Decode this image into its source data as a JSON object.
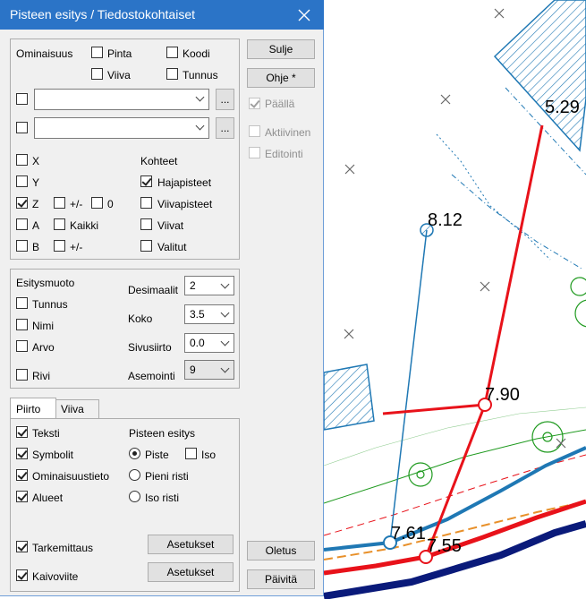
{
  "window": {
    "title": "Pisteen esitys / Tiedostokohtaiset"
  },
  "ominaisuus": {
    "label": "Ominaisuus",
    "pinta": "Pinta",
    "koodi": "Koodi",
    "viiva": "Viiva",
    "tunnus": "Tunnus",
    "browse": "..."
  },
  "coords": {
    "x": "X",
    "y": "Y",
    "z": "Z",
    "a": "A",
    "b": "B",
    "pm1": "+/-",
    "zero": "0",
    "kaikki": "Kaikki",
    "pm2": "+/-"
  },
  "kohteet": {
    "label": "Kohteet",
    "hajapisteet": "Hajapisteet",
    "viivapisteet": "Viivapisteet",
    "viivat": "Viivat",
    "valitut": "Valitut"
  },
  "buttons": {
    "sulje": "Sulje",
    "ohje": "Ohje *",
    "asetukset": "Asetukset",
    "oletus": "Oletus",
    "paivita": "Päivitä"
  },
  "right_options": {
    "paalla": "Päällä",
    "aktiivinen": "Aktiivinen",
    "editointi": "Editointi"
  },
  "esitysmuoto": {
    "label": "Esitysmuoto",
    "tunnus": "Tunnus",
    "nimi": "Nimi",
    "arvo": "Arvo",
    "rivi": "Rivi",
    "desimaalit_label": "Desimaalit",
    "desimaalit_value": "2",
    "koko_label": "Koko",
    "koko_value": "3.5",
    "sivusiirto_label": "Sivusiirto",
    "sivusiirto_value": "0.0",
    "asemointi_label": "Asemointi",
    "asemointi_value": "9"
  },
  "tabs": {
    "piirto": "Piirto",
    "viiva": "Viiva"
  },
  "piirto": {
    "teksti": "Teksti",
    "symbolit": "Symbolit",
    "ominaisuustieto": "Ominaisuustieto",
    "alueet": "Alueet",
    "pisteen_esitys": "Pisteen esitys",
    "piste": "Piste",
    "iso": "Iso",
    "pieni_risti": "Pieni risti",
    "iso_risti": "Iso risti",
    "tarkemittaus": "Tarkemittaus",
    "kaivoviite": "Kaivoviite"
  },
  "map": {
    "labels": {
      "p529": "5.29",
      "p812": "8.12",
      "p790": "7.90",
      "p761": "7.61",
      "p755": "7.55"
    },
    "colors": {
      "red": "#e8121a",
      "blue": "#1f78b4",
      "navy": "#0a1a7a",
      "green": "#1f9a1f",
      "orange": "#e8902a"
    }
  }
}
